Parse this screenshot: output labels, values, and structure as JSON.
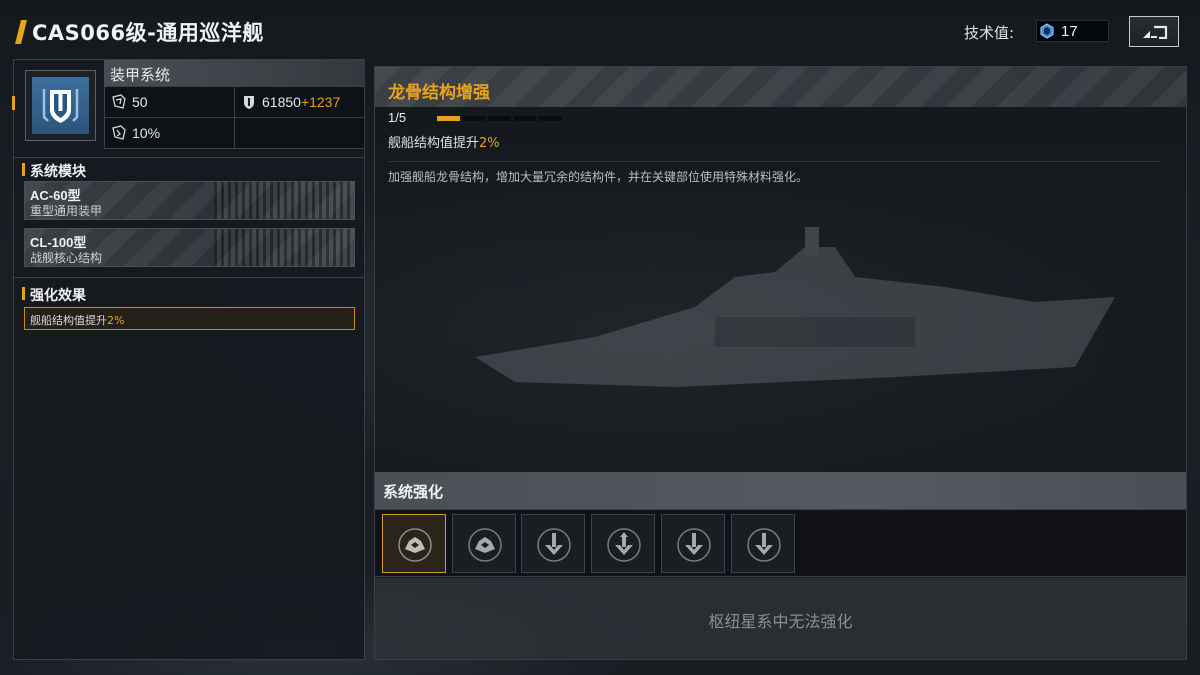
{
  "header": {
    "title": "CAS066级-通用巡洋舰",
    "tech_label": "技术值:",
    "tech_value": "17",
    "tech_icon": "tech-crystal-icon",
    "back_icon": "back-arrow-icon"
  },
  "armor": {
    "title": "装甲系统",
    "icon": "armor-shield-icon",
    "stats": {
      "stat1_value": "50",
      "stat2_value": "61850",
      "stat2_bonus": "+1237",
      "stat3_value": "10%"
    }
  },
  "modules": {
    "section_title": "系统模块",
    "items": [
      {
        "name": "AC-60型",
        "sub": "重型通用装甲"
      },
      {
        "name": "CL-100型",
        "sub": "战舰核心结构"
      }
    ]
  },
  "effects": {
    "section_title": "强化效果",
    "item_prefix": "舰船结构值提升",
    "item_value": "2%"
  },
  "detail": {
    "title": "龙骨结构增强",
    "level": "1/5",
    "level_fraction": 0.2,
    "effect_prefix": "舰船结构值提升",
    "effect_value": "2%",
    "description": "加强舰船龙骨结构，增加大量冗余的结构件，并在关键部位使用特殊材料强化。"
  },
  "enhance": {
    "title": "系统强化",
    "slots": [
      {
        "icon": "armor-plate-icon",
        "selected": true
      },
      {
        "icon": "armor-plate-icon",
        "selected": false
      },
      {
        "icon": "structure-arrow-icon",
        "selected": false
      },
      {
        "icon": "structure-arrow-icon",
        "selected": false
      },
      {
        "icon": "structure-arrow-icon",
        "selected": false
      },
      {
        "icon": "structure-arrow-icon",
        "selected": false
      }
    ],
    "disabled_message": "枢纽星系中无法强化"
  },
  "colors": {
    "accent": "#e8a21c",
    "armor_blue": "#3d6e9b"
  }
}
